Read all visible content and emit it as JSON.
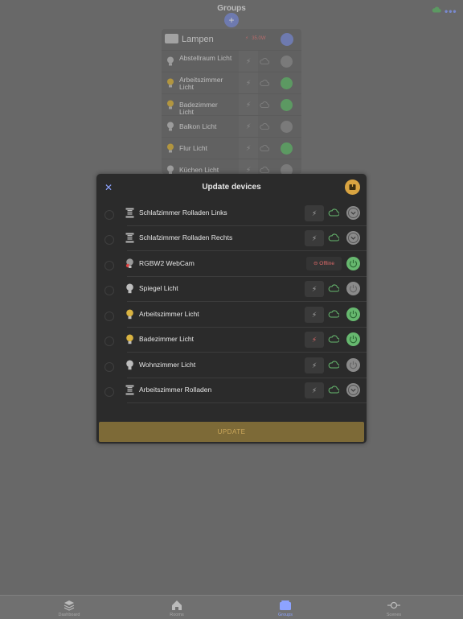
{
  "header": {
    "title": "Groups",
    "add_icon": "plus-icon",
    "cloud_icon": "cloud-icon",
    "more_icon": "ellipsis-icon"
  },
  "group": {
    "name": "Lampen",
    "power_value": "35.0W",
    "items": [
      {
        "label": "Abstellraum Licht",
        "bulb": "off",
        "power": "off"
      },
      {
        "label": "Arbeitszimmer Licht",
        "bulb": "on",
        "power": "on"
      },
      {
        "label": "Badezimmer Licht",
        "bulb": "on",
        "power": "on"
      },
      {
        "label": "Balkon Licht",
        "bulb": "off",
        "power": "off"
      },
      {
        "label": "Flur Licht",
        "bulb": "on",
        "power": "on"
      },
      {
        "label": "Küchen Licht",
        "bulb": "off",
        "power": "off"
      }
    ]
  },
  "modal": {
    "title": "Update devices",
    "close_icon": "close-icon",
    "upload_icon": "upload-icon",
    "button_label": "UPDATE",
    "devices": [
      {
        "label": "Schlafzimmer Rolladen Links",
        "type": "shutter",
        "status": "online",
        "action": "chevron"
      },
      {
        "label": "Schlafzimmer Rolladen Rechts",
        "type": "shutter",
        "status": "online",
        "action": "chevron"
      },
      {
        "label": "RGBW2 WebCam",
        "type": "rgb",
        "status": "offline",
        "status_text": "Offline",
        "action": "on"
      },
      {
        "label": "Spiegel Licht",
        "type": "bulb-off",
        "status": "online",
        "action": "off"
      },
      {
        "label": "Arbeitszimmer Licht",
        "type": "bulb-on",
        "status": "online",
        "action": "on"
      },
      {
        "label": "Badezimmer Licht",
        "type": "bulb-on",
        "status": "online",
        "action": "on",
        "bolt": "red"
      },
      {
        "label": "Wohnzimmer Licht",
        "type": "bulb-off",
        "status": "online",
        "action": "off"
      },
      {
        "label": "Arbeitszimmer Rolladen",
        "type": "shutter",
        "status": "online",
        "action": "chevron"
      }
    ]
  },
  "tabs": [
    {
      "label": "Dashboard",
      "icon": "layers-icon",
      "active": false
    },
    {
      "label": "Rooms",
      "icon": "house-icon",
      "active": false
    },
    {
      "label": "Groups",
      "icon": "groups-icon",
      "active": true
    },
    {
      "label": "Scenes",
      "icon": "scene-icon",
      "active": false
    }
  ],
  "colors": {
    "accent": "#8da3ff",
    "green": "#67b86f",
    "bulb_on": "#d9b341",
    "red": "#e06a6a",
    "update_bg": "#7d6a37"
  }
}
